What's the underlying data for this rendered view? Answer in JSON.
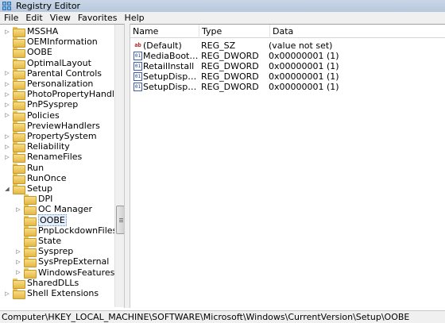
{
  "window": {
    "title": "Registry Editor"
  },
  "menu": [
    "File",
    "Edit",
    "View",
    "Favorites",
    "Help"
  ],
  "tree": {
    "items": [
      {
        "label": "MSSHA",
        "indent": 0,
        "exp": "right"
      },
      {
        "label": "OEMInformation",
        "indent": 0,
        "exp": "none"
      },
      {
        "label": "OOBE",
        "indent": 0,
        "exp": "none"
      },
      {
        "label": "OptimalLayout",
        "indent": 0,
        "exp": "none"
      },
      {
        "label": "Parental Controls",
        "indent": 0,
        "exp": "right"
      },
      {
        "label": "Personalization",
        "indent": 0,
        "exp": "right"
      },
      {
        "label": "PhotoPropertyHandler",
        "indent": 0,
        "exp": "right"
      },
      {
        "label": "PnPSysprep",
        "indent": 0,
        "exp": "right"
      },
      {
        "label": "Policies",
        "indent": 0,
        "exp": "right"
      },
      {
        "label": "PreviewHandlers",
        "indent": 0,
        "exp": "none"
      },
      {
        "label": "PropertySystem",
        "indent": 0,
        "exp": "right"
      },
      {
        "label": "Reliability",
        "indent": 0,
        "exp": "right"
      },
      {
        "label": "RenameFiles",
        "indent": 0,
        "exp": "right"
      },
      {
        "label": "Run",
        "indent": 0,
        "exp": "none"
      },
      {
        "label": "RunOnce",
        "indent": 0,
        "exp": "none"
      },
      {
        "label": "Setup",
        "indent": 0,
        "exp": "down"
      },
      {
        "label": "DPI",
        "indent": 1,
        "exp": "none"
      },
      {
        "label": "OC Manager",
        "indent": 1,
        "exp": "right"
      },
      {
        "label": "OOBE",
        "indent": 1,
        "exp": "none",
        "selected": true
      },
      {
        "label": "PnpLockdownFiles",
        "indent": 1,
        "exp": "none"
      },
      {
        "label": "State",
        "indent": 1,
        "exp": "none"
      },
      {
        "label": "Sysprep",
        "indent": 1,
        "exp": "right"
      },
      {
        "label": "SysPrepExternal",
        "indent": 1,
        "exp": "right"
      },
      {
        "label": "WindowsFeatures",
        "indent": 1,
        "exp": "right"
      },
      {
        "label": "SharedDLLs",
        "indent": 0,
        "exp": "none"
      },
      {
        "label": "Shell Extensions",
        "indent": 0,
        "exp": "right"
      }
    ]
  },
  "list": {
    "columns": [
      "Name",
      "Type",
      "Data"
    ],
    "rows": [
      {
        "name": "(Default)",
        "type": "REG_SZ",
        "data": "(value not set)",
        "icon": "string-value-icon"
      },
      {
        "name": "MediaBootInstall",
        "type": "REG_DWORD",
        "data": "0x00000001 (1)",
        "icon": "binary-value-icon"
      },
      {
        "name": "RetailInstall",
        "type": "REG_DWORD",
        "data": "0x00000001 (1)",
        "icon": "binary-value-icon"
      },
      {
        "name": "SetupDisplayedE...",
        "type": "REG_DWORD",
        "data": "0x00000001 (1)",
        "icon": "binary-value-icon"
      },
      {
        "name": "SetupDisplayedL...",
        "type": "REG_DWORD",
        "data": "0x00000001 (1)",
        "icon": "binary-value-icon"
      }
    ]
  },
  "status": {
    "path": "Computer\\HKEY_LOCAL_MACHINE\\SOFTWARE\\Microsoft\\Windows\\CurrentVersion\\Setup\\OOBE"
  }
}
